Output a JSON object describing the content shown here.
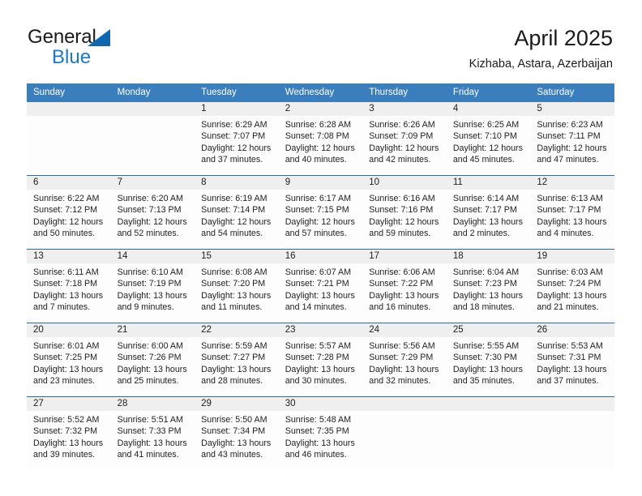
{
  "brand": {
    "name_part1": "General",
    "name_part2": "Blue",
    "triangle_icon": "blue-triangle-logo-icon",
    "color_primary": "#1167ae",
    "color_secondary": "#1c78c8"
  },
  "header": {
    "title": "April 2025",
    "subtitle": "Kizhaba, Astara, Azerbaijan"
  },
  "theme": {
    "header_blue": "#3b7ebe",
    "row_divider_blue": "#2b6cad",
    "daynum_band": "#efefef",
    "cell_bg": "#fdfdfd"
  },
  "weekday_headers": [
    "Sunday",
    "Monday",
    "Tuesday",
    "Wednesday",
    "Thursday",
    "Friday",
    "Saturday"
  ],
  "weeks": [
    [
      {
        "day": "",
        "sunrise": "",
        "sunset": "",
        "daylight_line1": "",
        "daylight_line2": ""
      },
      {
        "day": "",
        "sunrise": "",
        "sunset": "",
        "daylight_line1": "",
        "daylight_line2": ""
      },
      {
        "day": "1",
        "sunrise": "Sunrise: 6:29 AM",
        "sunset": "Sunset: 7:07 PM",
        "daylight_line1": "Daylight: 12 hours",
        "daylight_line2": "and 37 minutes."
      },
      {
        "day": "2",
        "sunrise": "Sunrise: 6:28 AM",
        "sunset": "Sunset: 7:08 PM",
        "daylight_line1": "Daylight: 12 hours",
        "daylight_line2": "and 40 minutes."
      },
      {
        "day": "3",
        "sunrise": "Sunrise: 6:26 AM",
        "sunset": "Sunset: 7:09 PM",
        "daylight_line1": "Daylight: 12 hours",
        "daylight_line2": "and 42 minutes."
      },
      {
        "day": "4",
        "sunrise": "Sunrise: 6:25 AM",
        "sunset": "Sunset: 7:10 PM",
        "daylight_line1": "Daylight: 12 hours",
        "daylight_line2": "and 45 minutes."
      },
      {
        "day": "5",
        "sunrise": "Sunrise: 6:23 AM",
        "sunset": "Sunset: 7:11 PM",
        "daylight_line1": "Daylight: 12 hours",
        "daylight_line2": "and 47 minutes."
      }
    ],
    [
      {
        "day": "6",
        "sunrise": "Sunrise: 6:22 AM",
        "sunset": "Sunset: 7:12 PM",
        "daylight_line1": "Daylight: 12 hours",
        "daylight_line2": "and 50 minutes."
      },
      {
        "day": "7",
        "sunrise": "Sunrise: 6:20 AM",
        "sunset": "Sunset: 7:13 PM",
        "daylight_line1": "Daylight: 12 hours",
        "daylight_line2": "and 52 minutes."
      },
      {
        "day": "8",
        "sunrise": "Sunrise: 6:19 AM",
        "sunset": "Sunset: 7:14 PM",
        "daylight_line1": "Daylight: 12 hours",
        "daylight_line2": "and 54 minutes."
      },
      {
        "day": "9",
        "sunrise": "Sunrise: 6:17 AM",
        "sunset": "Sunset: 7:15 PM",
        "daylight_line1": "Daylight: 12 hours",
        "daylight_line2": "and 57 minutes."
      },
      {
        "day": "10",
        "sunrise": "Sunrise: 6:16 AM",
        "sunset": "Sunset: 7:16 PM",
        "daylight_line1": "Daylight: 12 hours",
        "daylight_line2": "and 59 minutes."
      },
      {
        "day": "11",
        "sunrise": "Sunrise: 6:14 AM",
        "sunset": "Sunset: 7:17 PM",
        "daylight_line1": "Daylight: 13 hours",
        "daylight_line2": "and 2 minutes."
      },
      {
        "day": "12",
        "sunrise": "Sunrise: 6:13 AM",
        "sunset": "Sunset: 7:17 PM",
        "daylight_line1": "Daylight: 13 hours",
        "daylight_line2": "and 4 minutes."
      }
    ],
    [
      {
        "day": "13",
        "sunrise": "Sunrise: 6:11 AM",
        "sunset": "Sunset: 7:18 PM",
        "daylight_line1": "Daylight: 13 hours",
        "daylight_line2": "and 7 minutes."
      },
      {
        "day": "14",
        "sunrise": "Sunrise: 6:10 AM",
        "sunset": "Sunset: 7:19 PM",
        "daylight_line1": "Daylight: 13 hours",
        "daylight_line2": "and 9 minutes."
      },
      {
        "day": "15",
        "sunrise": "Sunrise: 6:08 AM",
        "sunset": "Sunset: 7:20 PM",
        "daylight_line1": "Daylight: 13 hours",
        "daylight_line2": "and 11 minutes."
      },
      {
        "day": "16",
        "sunrise": "Sunrise: 6:07 AM",
        "sunset": "Sunset: 7:21 PM",
        "daylight_line1": "Daylight: 13 hours",
        "daylight_line2": "and 14 minutes."
      },
      {
        "day": "17",
        "sunrise": "Sunrise: 6:06 AM",
        "sunset": "Sunset: 7:22 PM",
        "daylight_line1": "Daylight: 13 hours",
        "daylight_line2": "and 16 minutes."
      },
      {
        "day": "18",
        "sunrise": "Sunrise: 6:04 AM",
        "sunset": "Sunset: 7:23 PM",
        "daylight_line1": "Daylight: 13 hours",
        "daylight_line2": "and 18 minutes."
      },
      {
        "day": "19",
        "sunrise": "Sunrise: 6:03 AM",
        "sunset": "Sunset: 7:24 PM",
        "daylight_line1": "Daylight: 13 hours",
        "daylight_line2": "and 21 minutes."
      }
    ],
    [
      {
        "day": "20",
        "sunrise": "Sunrise: 6:01 AM",
        "sunset": "Sunset: 7:25 PM",
        "daylight_line1": "Daylight: 13 hours",
        "daylight_line2": "and 23 minutes."
      },
      {
        "day": "21",
        "sunrise": "Sunrise: 6:00 AM",
        "sunset": "Sunset: 7:26 PM",
        "daylight_line1": "Daylight: 13 hours",
        "daylight_line2": "and 25 minutes."
      },
      {
        "day": "22",
        "sunrise": "Sunrise: 5:59 AM",
        "sunset": "Sunset: 7:27 PM",
        "daylight_line1": "Daylight: 13 hours",
        "daylight_line2": "and 28 minutes."
      },
      {
        "day": "23",
        "sunrise": "Sunrise: 5:57 AM",
        "sunset": "Sunset: 7:28 PM",
        "daylight_line1": "Daylight: 13 hours",
        "daylight_line2": "and 30 minutes."
      },
      {
        "day": "24",
        "sunrise": "Sunrise: 5:56 AM",
        "sunset": "Sunset: 7:29 PM",
        "daylight_line1": "Daylight: 13 hours",
        "daylight_line2": "and 32 minutes."
      },
      {
        "day": "25",
        "sunrise": "Sunrise: 5:55 AM",
        "sunset": "Sunset: 7:30 PM",
        "daylight_line1": "Daylight: 13 hours",
        "daylight_line2": "and 35 minutes."
      },
      {
        "day": "26",
        "sunrise": "Sunrise: 5:53 AM",
        "sunset": "Sunset: 7:31 PM",
        "daylight_line1": "Daylight: 13 hours",
        "daylight_line2": "and 37 minutes."
      }
    ],
    [
      {
        "day": "27",
        "sunrise": "Sunrise: 5:52 AM",
        "sunset": "Sunset: 7:32 PM",
        "daylight_line1": "Daylight: 13 hours",
        "daylight_line2": "and 39 minutes."
      },
      {
        "day": "28",
        "sunrise": "Sunrise: 5:51 AM",
        "sunset": "Sunset: 7:33 PM",
        "daylight_line1": "Daylight: 13 hours",
        "daylight_line2": "and 41 minutes."
      },
      {
        "day": "29",
        "sunrise": "Sunrise: 5:50 AM",
        "sunset": "Sunset: 7:34 PM",
        "daylight_line1": "Daylight: 13 hours",
        "daylight_line2": "and 43 minutes."
      },
      {
        "day": "30",
        "sunrise": "Sunrise: 5:48 AM",
        "sunset": "Sunset: 7:35 PM",
        "daylight_line1": "Daylight: 13 hours",
        "daylight_line2": "and 46 minutes."
      },
      {
        "day": "",
        "sunrise": "",
        "sunset": "",
        "daylight_line1": "",
        "daylight_line2": ""
      },
      {
        "day": "",
        "sunrise": "",
        "sunset": "",
        "daylight_line1": "",
        "daylight_line2": ""
      },
      {
        "day": "",
        "sunrise": "",
        "sunset": "",
        "daylight_line1": "",
        "daylight_line2": ""
      }
    ]
  ]
}
